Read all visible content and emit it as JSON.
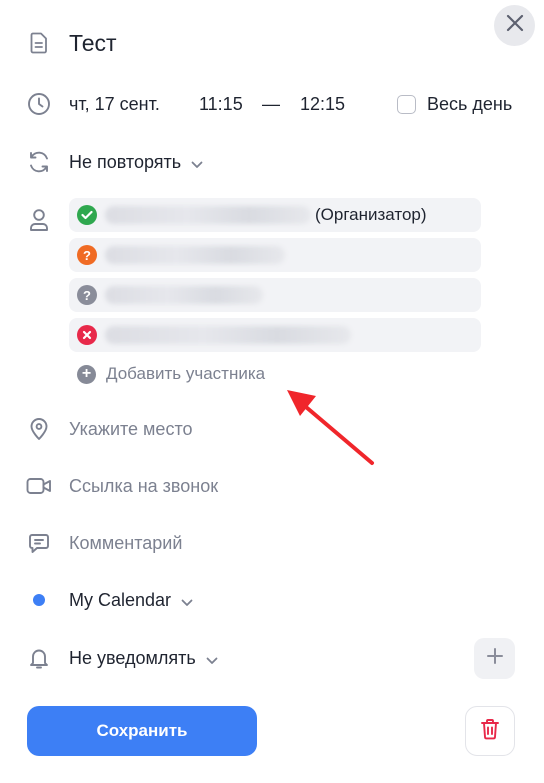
{
  "event": {
    "title": "Тест",
    "date": "чт, 17 сент.",
    "time_start": "11:15",
    "time_separator": "—",
    "time_end": "12:15",
    "all_day_label": "Весь день",
    "all_day_checked": false,
    "repeat": "Не повторять"
  },
  "attendees": {
    "items": [
      {
        "status": "accepted",
        "status_color": "#2fa84f",
        "suffix": "(Организатор)"
      },
      {
        "status": "tentative",
        "status_color": "#f06b24",
        "suffix": ""
      },
      {
        "status": "unknown",
        "status_color": "#8a8d9a",
        "suffix": ""
      },
      {
        "status": "declined",
        "status_color": "#e8294a",
        "suffix": ""
      }
    ],
    "add_label": "Добавить участника"
  },
  "fields": {
    "location_placeholder": "Укажите место",
    "call_link_placeholder": "Ссылка на звонок",
    "comment_placeholder": "Комментарий"
  },
  "calendar": {
    "name": "My Calendar",
    "color": "#3d7ff5"
  },
  "notification": {
    "value": "Не уведомлять"
  },
  "actions": {
    "save_label": "Сохранить"
  },
  "annotation": {
    "arrow_color": "#f0262b"
  },
  "icons": {
    "close": "close-icon",
    "title": "document-icon",
    "time": "clock-icon",
    "repeat": "repeat-icon",
    "attendees": "person-icon",
    "location": "location-pin-icon",
    "call": "video-camera-icon",
    "comment": "comment-icon",
    "notification": "bell-icon",
    "add": "plus-icon",
    "delete": "trash-icon"
  }
}
